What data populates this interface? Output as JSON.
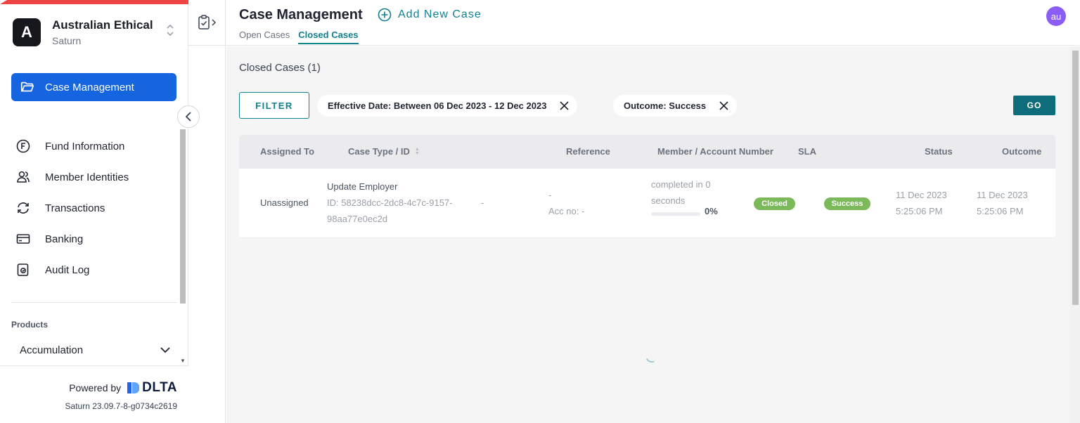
{
  "sidebar": {
    "org_initial": "A",
    "org_name": "Australian Ethical",
    "org_sub": "Saturn",
    "primary_item": {
      "label": "Case Management",
      "icon": "folder-open-icon"
    },
    "items": [
      {
        "label": "Fund Information",
        "icon": "fund-f-circle-icon"
      },
      {
        "label": "Member Identities",
        "icon": "users-icon"
      },
      {
        "label": "Transactions",
        "icon": "refresh-icon"
      },
      {
        "label": "Banking",
        "icon": "credit-card-icon"
      },
      {
        "label": "Audit Log",
        "icon": "audit-log-icon"
      }
    ],
    "products_label": "Products",
    "products_item": "Accumulation",
    "powered_by": "Powered by",
    "brand": "DLTA",
    "version": "Saturn 23.09.7-8-g0734c2619"
  },
  "header": {
    "title": "Case Management",
    "add_label": "Add New Case",
    "tabs": [
      "Open Cases",
      "Closed Cases"
    ],
    "active_tab": "Closed Cases",
    "avatar": "au"
  },
  "main": {
    "section_title": "Closed Cases (1)",
    "filter_label": "FILTER",
    "chips": [
      "Effective Date: Between 06 Dec 2023 - 12 Dec 2023",
      "Outcome: Success"
    ],
    "go_label": "GO",
    "columns": [
      "Assigned To",
      "Case Type / ID",
      "Reference",
      "Member / Account Number",
      "SLA",
      "Status",
      "Outcome"
    ],
    "rows": [
      {
        "assigned_to": "Unassigned",
        "case_type": "Update Employer",
        "case_id_line1": "ID: 58238dcc-2dc8-4c7c-9157-",
        "case_id_line2": "98aa77e0ec2d",
        "reference": "-",
        "member": "-",
        "account": "Acc no: -",
        "sla_line1": "completed in 0",
        "sla_line2": "seconds",
        "sla_progress": 0,
        "sla_pct": "0%",
        "status_badge": "Closed",
        "outcome_badge": "Success",
        "status_date": "11 Dec 2023",
        "status_time": "5:25:06 PM",
        "outcome_date": "11 Dec 2023",
        "outcome_time": "5:25:06 PM"
      }
    ]
  },
  "colors": {
    "primary": "#1565e0",
    "teal": "#11808f",
    "success_badge": "#7cb95a",
    "avatar": "#8b5cf6"
  }
}
